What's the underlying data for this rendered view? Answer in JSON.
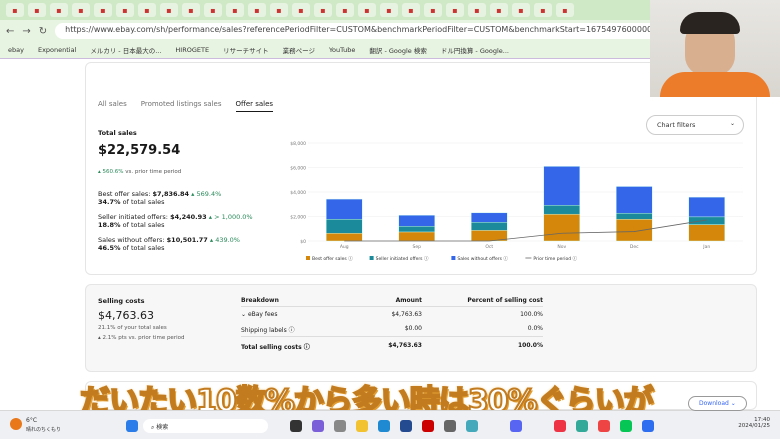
{
  "browser": {
    "url": "https://www.ebay.com/sh/performance/sales?referencePeriodFilter=CUSTOM&benchmarkPeriodFilter=CUSTOM&benchmarkStart=1675497600000&referenceEnd=17061...",
    "bookmarks": [
      "ebay",
      "Exponential",
      "メルカリ - 日本最大の...",
      "HIROGETE",
      "リサーチサイト",
      "業務ページ",
      "YouTube",
      "翻訳 - Google 検索",
      "ドル円換算 - Google..."
    ]
  },
  "tabs": [
    "All sales",
    "Promoted listings sales",
    "Offer sales"
  ],
  "total_sales": {
    "label": "Total sales",
    "value": "$22,579.54",
    "change": "560.6%",
    "change_suffix": "vs. prior time period",
    "breakdown": [
      {
        "label": "Best offer sales:",
        "value": "$7,836.84",
        "change": "569.4%",
        "share": "34.7%",
        "share_suffix": "of total sales"
      },
      {
        "label": "Seller initiated offers:",
        "value": "$4,240.93",
        "change": "> 1,000.0%",
        "share": "18.8%",
        "share_suffix": "of total sales"
      },
      {
        "label": "Sales without offers:",
        "value": "$10,501.77",
        "change": "439.0%",
        "share": "46.5%",
        "share_suffix": "of total sales"
      }
    ]
  },
  "chart_filters_label": "Chart filters",
  "chart_data": {
    "type": "bar",
    "stacked": true,
    "categories": [
      "Aug",
      "Sep",
      "Oct",
      "Nov",
      "Dec",
      "Jan"
    ],
    "yticks": [
      "$0",
      "$2,000",
      "$4,000",
      "$6,000",
      "$8,000"
    ],
    "ylim": [
      0,
      8000
    ],
    "grid": true,
    "legend": "bottom",
    "series": [
      {
        "name": "Best offer sales",
        "color": "#d4870a",
        "values": [
          630,
          740,
          870,
          2190,
          1780,
          1340
        ]
      },
      {
        "name": "Seller initiated offers",
        "color": "#1b8a9a",
        "values": [
          1150,
          460,
          660,
          730,
          490,
          630
        ]
      },
      {
        "name": "Sales without offers",
        "color": "#3366e8",
        "values": [
          1640,
          900,
          770,
          3170,
          2180,
          1610
        ]
      }
    ],
    "line": {
      "name": "Prior time period",
      "color": "#666666",
      "values": [
        0,
        0,
        0,
        630,
        770,
        1720
      ]
    }
  },
  "selling_costs": {
    "label": "Selling costs",
    "value": "$4,763.63",
    "share": "21.1% of your total sales",
    "change": "2.1% pts vs. prior time period",
    "headers": [
      "Breakdown",
      "Amount",
      "Percent of selling cost"
    ],
    "rows": [
      {
        "name": "eBay fees",
        "amount": "$4,763.63",
        "percent": "100.0%"
      },
      {
        "name": "Shipping labels",
        "amount": "$0.00",
        "percent": "0.0%"
      }
    ],
    "total": {
      "name": "Total selling costs",
      "amount": "$4,763.63",
      "percent": "100.0%"
    }
  },
  "download_label": "Download",
  "caption": "だいたい10数%から多い時は30%ぐらいが",
  "taskbar": {
    "weather_temp": "6°C",
    "weather_desc": "晴れのちくもり",
    "search_placeholder": "検索",
    "time": "17:40",
    "date": "2024/01/25"
  }
}
